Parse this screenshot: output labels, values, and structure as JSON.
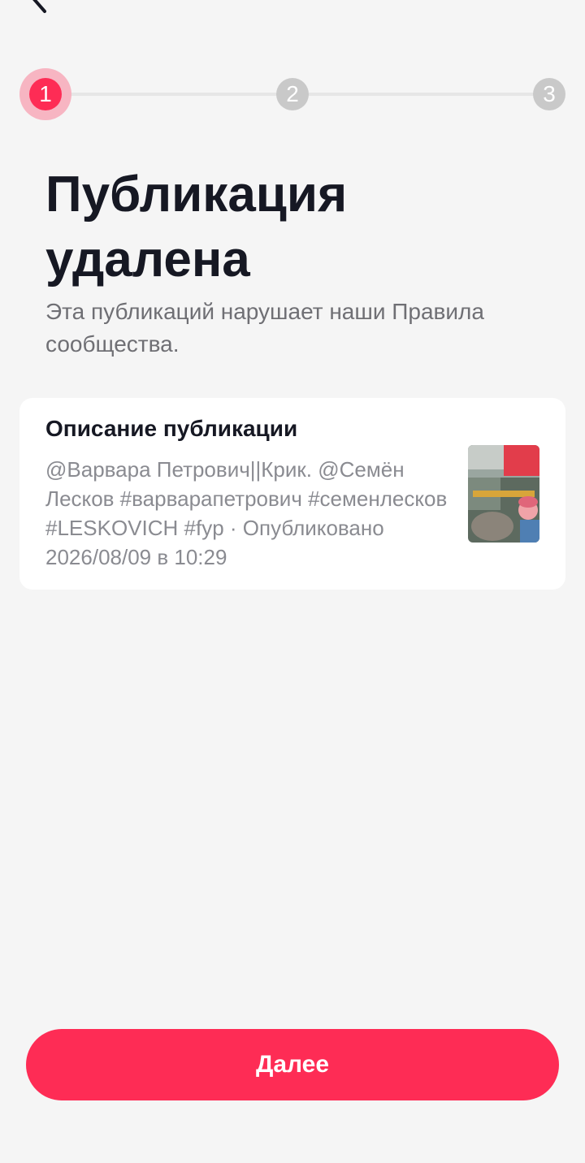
{
  "header": {
    "back_icon": "chevron-left-icon"
  },
  "stepper": {
    "steps": [
      "1",
      "2",
      "3"
    ],
    "current": 1,
    "colors": {
      "active": "#fe2c55",
      "active_ring": "#f7b5c2",
      "inactive": "#c9c9c9"
    }
  },
  "main": {
    "title": "Публикация удалена",
    "subtitle": "Эта публикаций нарушает наши Правила сообщества."
  },
  "card": {
    "title": "Описание публикации",
    "description": "@Варвара Петрович||Крик. @Семён Лесков #варварапетрович #семенлесков #LESKOVICH #fyp · Опубликовано 2026/08/09 в 10:29"
  },
  "footer": {
    "next_label": "Далее"
  },
  "colors": {
    "accent": "#fe2c55",
    "background": "#f5f5f5"
  }
}
